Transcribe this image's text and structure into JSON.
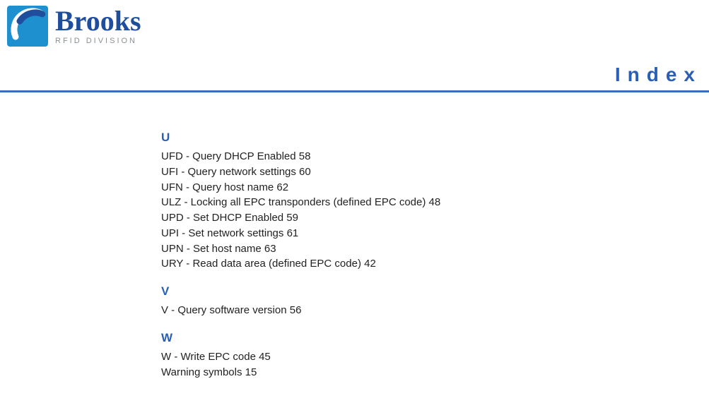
{
  "brand": {
    "name": "Brooks",
    "subline": "RFID DIVISION"
  },
  "page_title": "Index",
  "sections": [
    {
      "letter": "U",
      "entries": [
        "UFD - Query DHCP Enabled 58",
        "UFI - Query network settings 60",
        "UFN - Query host name 62",
        "ULZ - Locking all EPC transponders (defined EPC code) 48",
        "UPD - Set DHCP Enabled 59",
        "UPI - Set network settings 61",
        "UPN - Set host name 63",
        "URY - Read data area (defined EPC code) 42"
      ]
    },
    {
      "letter": "V",
      "entries": [
        "V - Query software version 56"
      ]
    },
    {
      "letter": "W",
      "entries": [
        "W - Write EPC code 45",
        "Warning symbols 15"
      ]
    }
  ]
}
